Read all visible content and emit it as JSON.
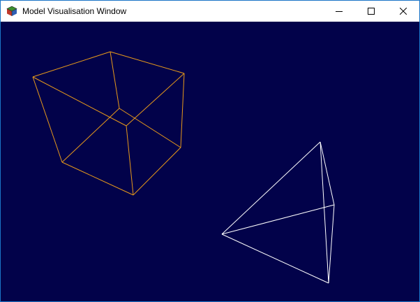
{
  "window": {
    "title": "Model Visualisation Window",
    "icon": "cube-app-icon"
  },
  "caption_buttons": {
    "minimize": "minimize-icon",
    "maximize": "maximize-icon",
    "close": "close-icon"
  },
  "viewport": {
    "background_color": "#02024a",
    "models": [
      {
        "name": "cube",
        "wire_color": "#e89a1a"
      },
      {
        "name": "tetrahedron",
        "wire_color": "#ffffff"
      }
    ]
  }
}
